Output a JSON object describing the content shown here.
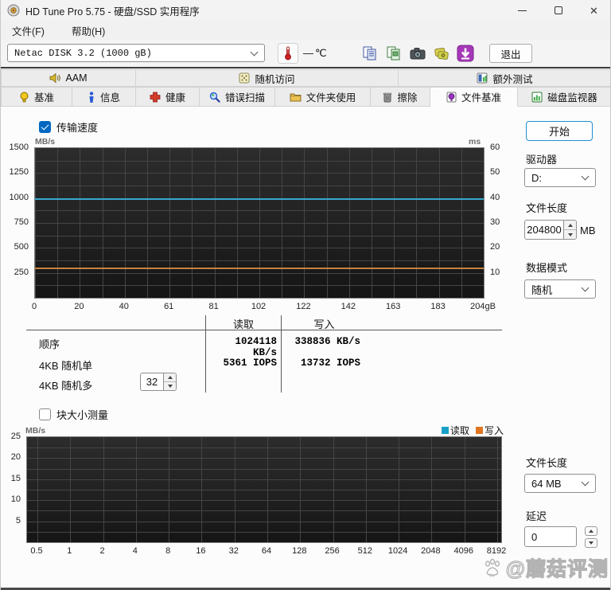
{
  "window": {
    "title": "HD Tune Pro 5.75 - 硬盘/SSD 实用程序"
  },
  "menu": {
    "file": "文件(F)",
    "help": "帮助(H)"
  },
  "toolbar": {
    "drive_select_value": "Netac  DISK 3.2 (1000 gB)",
    "temp_value": "—",
    "temp_unit": "℃",
    "exit_label": "退出",
    "icons": [
      "thermometer-icon",
      "copy-text-icon",
      "copy-image-icon",
      "screenshot-icon",
      "save-results-icon",
      "download-icon"
    ]
  },
  "tabs": {
    "row1": [
      {
        "label": "AAM",
        "icon": "speaker-icon"
      },
      {
        "label": "随机访问",
        "icon": "random-access-icon"
      },
      {
        "label": "额外测试",
        "icon": "extra-test-icon"
      }
    ],
    "row2": [
      {
        "label": "基准",
        "icon": "benchmark-icon"
      },
      {
        "label": "信息",
        "icon": "info-icon"
      },
      {
        "label": "健康",
        "icon": "health-icon"
      },
      {
        "label": "错误扫描",
        "icon": "error-scan-icon"
      },
      {
        "label": "文件夹使用",
        "icon": "folder-icon"
      },
      {
        "label": "擦除",
        "icon": "erase-icon"
      },
      {
        "label": "文件基准",
        "icon": "file-benchmark-icon",
        "active": true
      },
      {
        "label": "磁盘监视器",
        "icon": "disk-monitor-icon"
      }
    ]
  },
  "file_benchmark": {
    "transfer_checkbox_label": "传输速度",
    "transfer_checked": true,
    "block_checkbox_label": "块大小测量",
    "block_checked": false,
    "results": {
      "col_read": "读取",
      "col_write": "写入",
      "rows": [
        {
          "label": "顺序",
          "read": "1024118 KB/s",
          "write": "338836 KB/s"
        },
        {
          "label": "4KB 随机单",
          "read": "5361 IOPS",
          "write": "13732 IOPS"
        },
        {
          "label": "4KB 随机多",
          "queue_depth": "32"
        }
      ]
    },
    "legend": {
      "read": "读取",
      "write": "写入"
    }
  },
  "side_panel": {
    "start_button": "开始",
    "drive_label": "驱动器",
    "drive_value": "D:",
    "file_length_label": "文件长度",
    "file_length_value": "204800",
    "file_length_unit": "MB",
    "data_mode_label": "数据模式",
    "data_mode_value": "随机",
    "block_file_length_label": "文件长度",
    "block_file_length_value": "64 MB",
    "delay_label": "延迟",
    "delay_value": "0"
  },
  "chart_data": [
    {
      "type": "line",
      "title": "传输速度 (transfer speed over disk position)",
      "ylabel": "MB/s",
      "y2label": "ms",
      "ymax": 1500,
      "grid_step": 125,
      "yticks": [
        1500,
        1250,
        1000,
        750,
        500,
        250
      ],
      "y2max": 60,
      "y2ticks": [
        60,
        50,
        40,
        30,
        20,
        10
      ],
      "xticks": [
        "0",
        "20",
        "40",
        "61",
        "81",
        "102",
        "122",
        "142",
        "163",
        "183",
        "204gB"
      ],
      "x_subdiv": 2,
      "x_inset": [
        0,
        0
      ],
      "xlim_gb": [
        0,
        204
      ],
      "series": [
        {
          "name": "读取",
          "value": 990,
          "unit": "MB/s",
          "color": "#36a9cf",
          "shape": "flat"
        },
        {
          "name": "写入",
          "value": 292,
          "unit": "MB/s",
          "color": "#c8823c",
          "shape": "flat-noisy"
        }
      ],
      "legend_position": "none",
      "grid": true
    },
    {
      "type": "line",
      "title": "块大小测量 (block size sweep, no data)",
      "ylabel": "MB/s",
      "ymax": 25,
      "grid_step": 2.5,
      "yticks": [
        25,
        20,
        15,
        10,
        5
      ],
      "xticks": [
        "0.5",
        "1",
        "2",
        "4",
        "8",
        "16",
        "32",
        "64",
        "128",
        "256",
        "512",
        "1024",
        "2048",
        "4096",
        "8192"
      ],
      "x_subdiv": 1,
      "x_inset": [
        13,
        5
      ],
      "series": [],
      "legend_entries": [
        "读取",
        "写入"
      ],
      "legend_colors": {
        "read": "#18a0c8",
        "write": "#e07522"
      },
      "legend_position": "top-right",
      "grid": true
    }
  ],
  "watermark": {
    "text": "@蘑菇评测",
    "icon": "paw-icon"
  }
}
